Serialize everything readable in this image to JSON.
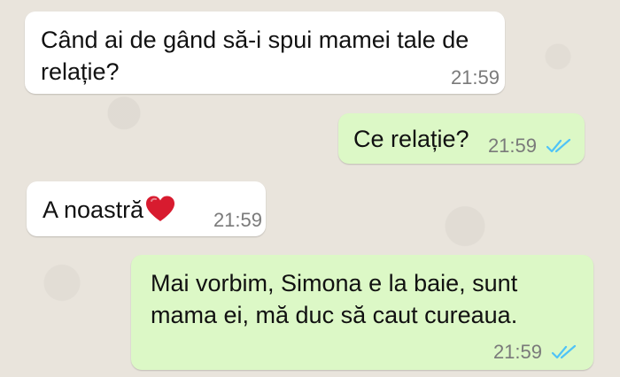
{
  "chat": {
    "messages": [
      {
        "direction": "incoming",
        "text": "Când ai de gând să-i spui mamei tale de relație?",
        "time": "21:59"
      },
      {
        "direction": "outgoing",
        "text": "Ce relație?",
        "time": "21:59",
        "status_icon": "double-check-read-icon"
      },
      {
        "direction": "incoming",
        "text": "A noastră",
        "emoji": "red-heart-icon",
        "time": "21:59"
      },
      {
        "direction": "outgoing",
        "text": "Mai vorbim, Simona e la baie, sunt mama ei, mă duc să caut cureaua.",
        "time": "21:59",
        "status_icon": "double-check-read-icon"
      }
    ]
  },
  "colors": {
    "incoming_bubble": "#ffffff",
    "outgoing_bubble": "#dcf8c6",
    "read_ticks": "#4fc3f7",
    "background": "#ece5dd"
  }
}
